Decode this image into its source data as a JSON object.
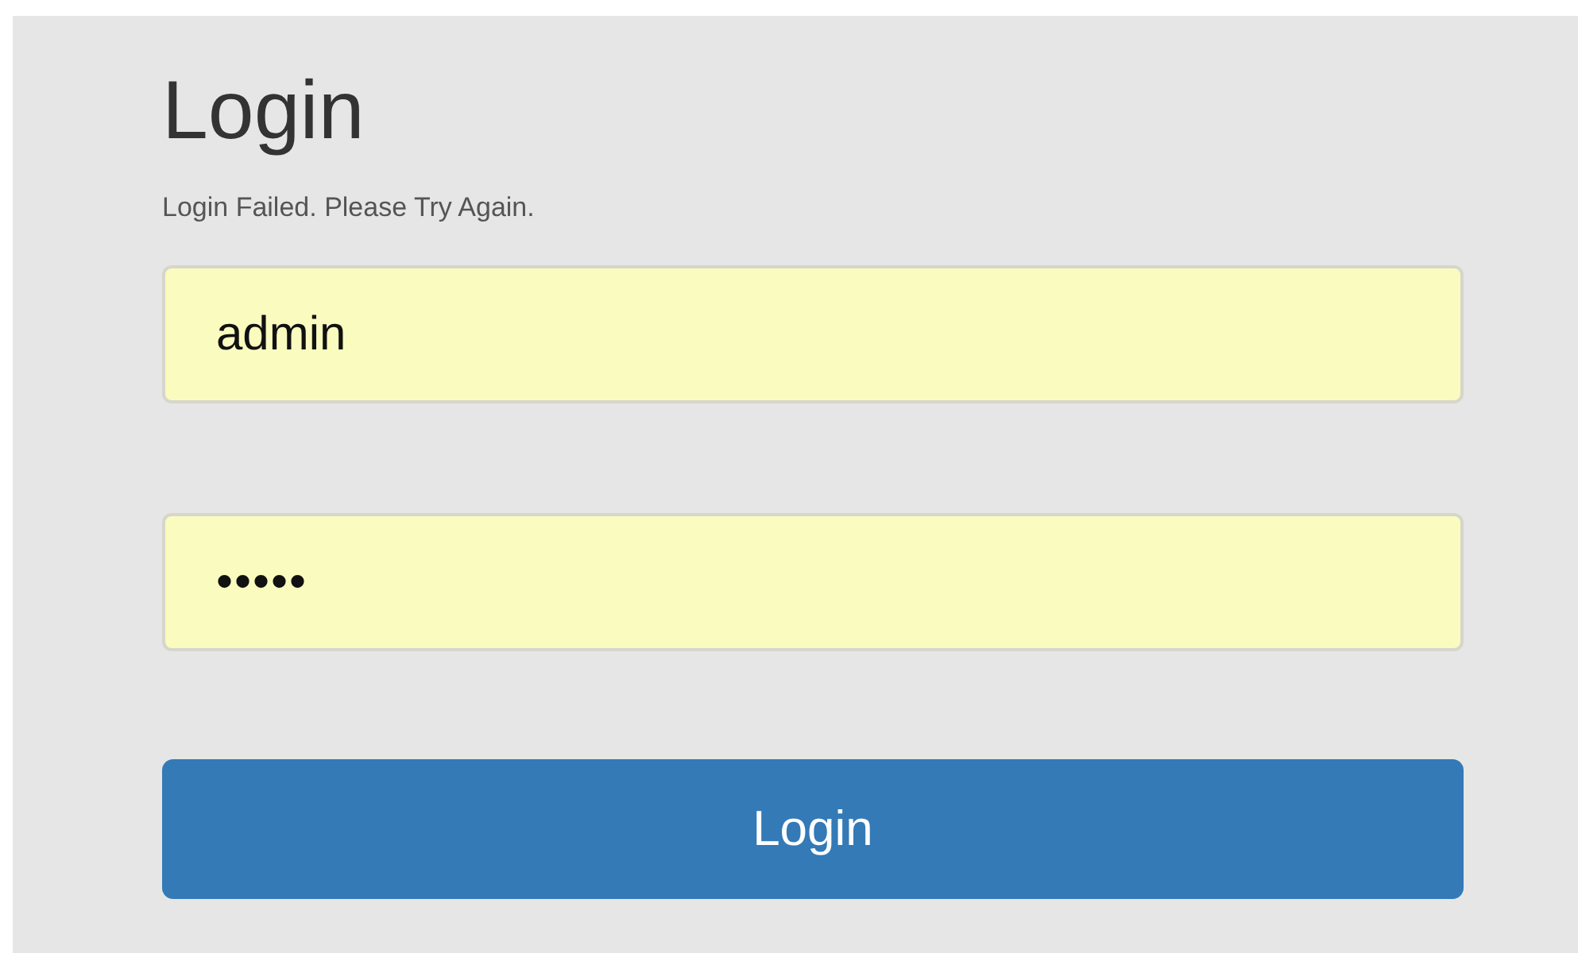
{
  "title": "Login",
  "message": "Login Failed. Please Try Again.",
  "fields": [
    {
      "kind": "text",
      "value": "admin"
    },
    {
      "kind": "password",
      "value": "•••••"
    }
  ],
  "button": {
    "label": "Login"
  }
}
